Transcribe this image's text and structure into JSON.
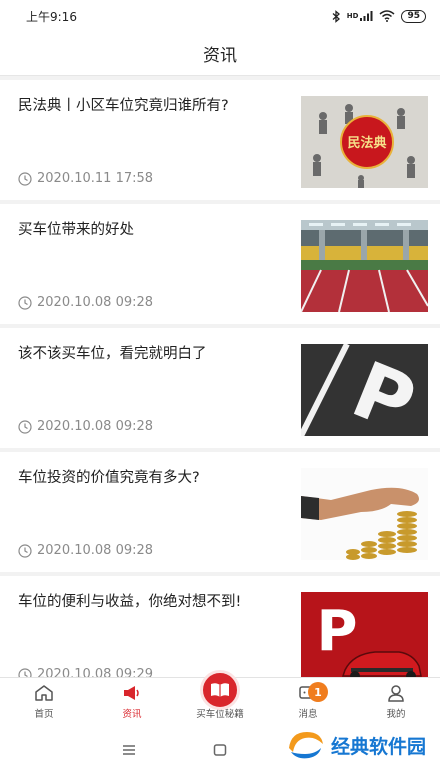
{
  "status_bar": {
    "time": "上午9:16",
    "signal": "HD",
    "battery": "95"
  },
  "header": {
    "title": "资讯"
  },
  "news": [
    {
      "title": "民法典丨小区车位究竟归谁所有?",
      "time": "2020.10.11 17:58",
      "thumb_text": "民法典"
    },
    {
      "title": "买车位带来的好处",
      "time": "2020.10.08 09:28"
    },
    {
      "title": "该不该买车位，看完就明白了",
      "time": "2020.10.08 09:28",
      "thumb_text": "P"
    },
    {
      "title": "车位投资的价值究竟有多大?",
      "time": "2020.10.08 09:28"
    },
    {
      "title": "车位的便利与收益，你绝对想不到!",
      "time": "2020.10.08 09:29",
      "thumb_text": "P"
    }
  ],
  "tabs": [
    {
      "label": "首页",
      "icon": "home-icon"
    },
    {
      "label": "资讯",
      "icon": "megaphone-icon"
    },
    {
      "label": "买车位秘籍",
      "icon": "book-icon"
    },
    {
      "label": "消息",
      "icon": "chat-icon",
      "badge": "1"
    },
    {
      "label": "我的",
      "icon": "person-icon"
    }
  ],
  "watermark": {
    "text": "经典软件园"
  },
  "colors": {
    "accent": "#d9262c",
    "badge": "#f07d1e",
    "watermark": "#1677d2"
  }
}
